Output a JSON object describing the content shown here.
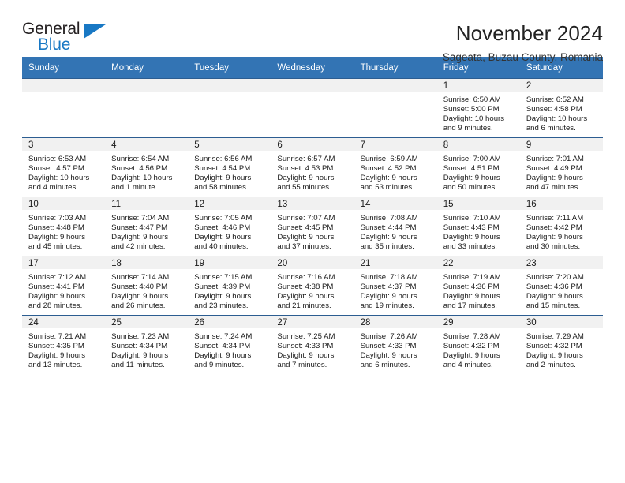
{
  "brand": {
    "name_top": "General",
    "name_bottom": "Blue",
    "triangle_color": "#1878c4",
    "accent_color": "#3374b4"
  },
  "header": {
    "title": "November 2024",
    "subtitle": "Sageata, Buzau County, Romania"
  },
  "weekday_headers": [
    "Sunday",
    "Monday",
    "Tuesday",
    "Wednesday",
    "Thursday",
    "Friday",
    "Saturday"
  ],
  "labels": {
    "sunrise": "Sunrise:",
    "sunset": "Sunset:",
    "daylight": "Daylight:"
  },
  "weeks": [
    [
      {
        "empty": true
      },
      {
        "empty": true
      },
      {
        "empty": true
      },
      {
        "empty": true
      },
      {
        "empty": true
      },
      {
        "day": "1",
        "sunrise": "Sunrise: 6:50 AM",
        "sunset": "Sunset: 5:00 PM",
        "daylight_1": "Daylight: 10 hours",
        "daylight_2": "and 9 minutes."
      },
      {
        "day": "2",
        "sunrise": "Sunrise: 6:52 AM",
        "sunset": "Sunset: 4:58 PM",
        "daylight_1": "Daylight: 10 hours",
        "daylight_2": "and 6 minutes."
      }
    ],
    [
      {
        "day": "3",
        "sunrise": "Sunrise: 6:53 AM",
        "sunset": "Sunset: 4:57 PM",
        "daylight_1": "Daylight: 10 hours",
        "daylight_2": "and 4 minutes."
      },
      {
        "day": "4",
        "sunrise": "Sunrise: 6:54 AM",
        "sunset": "Sunset: 4:56 PM",
        "daylight_1": "Daylight: 10 hours",
        "daylight_2": "and 1 minute."
      },
      {
        "day": "5",
        "sunrise": "Sunrise: 6:56 AM",
        "sunset": "Sunset: 4:54 PM",
        "daylight_1": "Daylight: 9 hours",
        "daylight_2": "and 58 minutes."
      },
      {
        "day": "6",
        "sunrise": "Sunrise: 6:57 AM",
        "sunset": "Sunset: 4:53 PM",
        "daylight_1": "Daylight: 9 hours",
        "daylight_2": "and 55 minutes."
      },
      {
        "day": "7",
        "sunrise": "Sunrise: 6:59 AM",
        "sunset": "Sunset: 4:52 PM",
        "daylight_1": "Daylight: 9 hours",
        "daylight_2": "and 53 minutes."
      },
      {
        "day": "8",
        "sunrise": "Sunrise: 7:00 AM",
        "sunset": "Sunset: 4:51 PM",
        "daylight_1": "Daylight: 9 hours",
        "daylight_2": "and 50 minutes."
      },
      {
        "day": "9",
        "sunrise": "Sunrise: 7:01 AM",
        "sunset": "Sunset: 4:49 PM",
        "daylight_1": "Daylight: 9 hours",
        "daylight_2": "and 47 minutes."
      }
    ],
    [
      {
        "day": "10",
        "sunrise": "Sunrise: 7:03 AM",
        "sunset": "Sunset: 4:48 PM",
        "daylight_1": "Daylight: 9 hours",
        "daylight_2": "and 45 minutes."
      },
      {
        "day": "11",
        "sunrise": "Sunrise: 7:04 AM",
        "sunset": "Sunset: 4:47 PM",
        "daylight_1": "Daylight: 9 hours",
        "daylight_2": "and 42 minutes."
      },
      {
        "day": "12",
        "sunrise": "Sunrise: 7:05 AM",
        "sunset": "Sunset: 4:46 PM",
        "daylight_1": "Daylight: 9 hours",
        "daylight_2": "and 40 minutes."
      },
      {
        "day": "13",
        "sunrise": "Sunrise: 7:07 AM",
        "sunset": "Sunset: 4:45 PM",
        "daylight_1": "Daylight: 9 hours",
        "daylight_2": "and 37 minutes."
      },
      {
        "day": "14",
        "sunrise": "Sunrise: 7:08 AM",
        "sunset": "Sunset: 4:44 PM",
        "daylight_1": "Daylight: 9 hours",
        "daylight_2": "and 35 minutes."
      },
      {
        "day": "15",
        "sunrise": "Sunrise: 7:10 AM",
        "sunset": "Sunset: 4:43 PM",
        "daylight_1": "Daylight: 9 hours",
        "daylight_2": "and 33 minutes."
      },
      {
        "day": "16",
        "sunrise": "Sunrise: 7:11 AM",
        "sunset": "Sunset: 4:42 PM",
        "daylight_1": "Daylight: 9 hours",
        "daylight_2": "and 30 minutes."
      }
    ],
    [
      {
        "day": "17",
        "sunrise": "Sunrise: 7:12 AM",
        "sunset": "Sunset: 4:41 PM",
        "daylight_1": "Daylight: 9 hours",
        "daylight_2": "and 28 minutes."
      },
      {
        "day": "18",
        "sunrise": "Sunrise: 7:14 AM",
        "sunset": "Sunset: 4:40 PM",
        "daylight_1": "Daylight: 9 hours",
        "daylight_2": "and 26 minutes."
      },
      {
        "day": "19",
        "sunrise": "Sunrise: 7:15 AM",
        "sunset": "Sunset: 4:39 PM",
        "daylight_1": "Daylight: 9 hours",
        "daylight_2": "and 23 minutes."
      },
      {
        "day": "20",
        "sunrise": "Sunrise: 7:16 AM",
        "sunset": "Sunset: 4:38 PM",
        "daylight_1": "Daylight: 9 hours",
        "daylight_2": "and 21 minutes."
      },
      {
        "day": "21",
        "sunrise": "Sunrise: 7:18 AM",
        "sunset": "Sunset: 4:37 PM",
        "daylight_1": "Daylight: 9 hours",
        "daylight_2": "and 19 minutes."
      },
      {
        "day": "22",
        "sunrise": "Sunrise: 7:19 AM",
        "sunset": "Sunset: 4:36 PM",
        "daylight_1": "Daylight: 9 hours",
        "daylight_2": "and 17 minutes."
      },
      {
        "day": "23",
        "sunrise": "Sunrise: 7:20 AM",
        "sunset": "Sunset: 4:36 PM",
        "daylight_1": "Daylight: 9 hours",
        "daylight_2": "and 15 minutes."
      }
    ],
    [
      {
        "day": "24",
        "sunrise": "Sunrise: 7:21 AM",
        "sunset": "Sunset: 4:35 PM",
        "daylight_1": "Daylight: 9 hours",
        "daylight_2": "and 13 minutes."
      },
      {
        "day": "25",
        "sunrise": "Sunrise: 7:23 AM",
        "sunset": "Sunset: 4:34 PM",
        "daylight_1": "Daylight: 9 hours",
        "daylight_2": "and 11 minutes."
      },
      {
        "day": "26",
        "sunrise": "Sunrise: 7:24 AM",
        "sunset": "Sunset: 4:34 PM",
        "daylight_1": "Daylight: 9 hours",
        "daylight_2": "and 9 minutes."
      },
      {
        "day": "27",
        "sunrise": "Sunrise: 7:25 AM",
        "sunset": "Sunset: 4:33 PM",
        "daylight_1": "Daylight: 9 hours",
        "daylight_2": "and 7 minutes."
      },
      {
        "day": "28",
        "sunrise": "Sunrise: 7:26 AM",
        "sunset": "Sunset: 4:33 PM",
        "daylight_1": "Daylight: 9 hours",
        "daylight_2": "and 6 minutes."
      },
      {
        "day": "29",
        "sunrise": "Sunrise: 7:28 AM",
        "sunset": "Sunset: 4:32 PM",
        "daylight_1": "Daylight: 9 hours",
        "daylight_2": "and 4 minutes."
      },
      {
        "day": "30",
        "sunrise": "Sunrise: 7:29 AM",
        "sunset": "Sunset: 4:32 PM",
        "daylight_1": "Daylight: 9 hours",
        "daylight_2": "and 2 minutes."
      }
    ]
  ]
}
